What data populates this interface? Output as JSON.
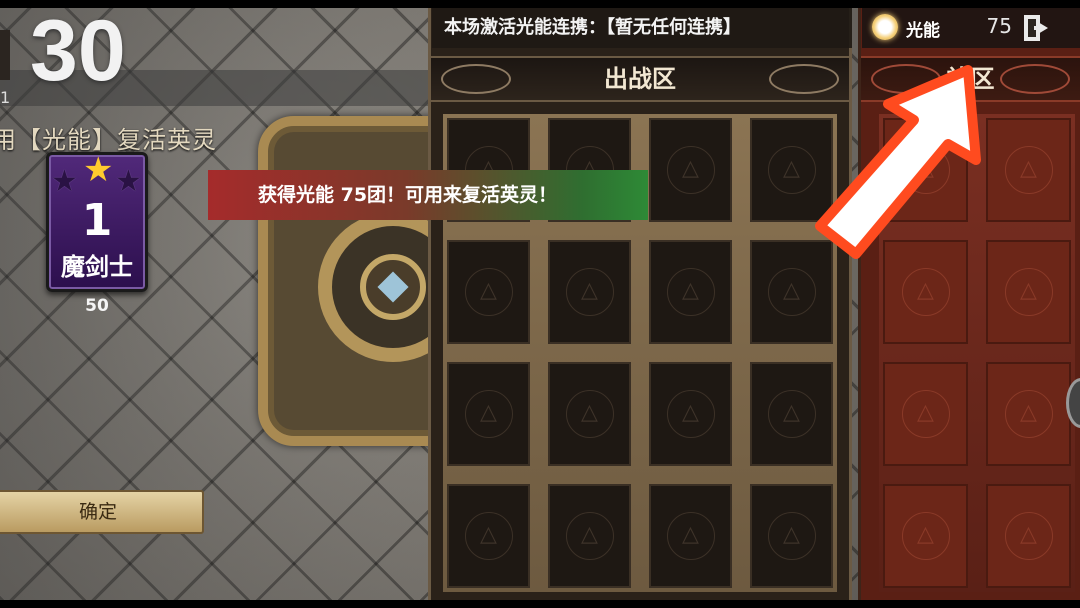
{
  "hud": {
    "counter": "30",
    "sub_number": "1",
    "hint_text": "用【光能】复活英灵"
  },
  "hero_card": {
    "level": "1",
    "name": "魔剑士",
    "cost": "50",
    "stars_filled": 1,
    "stars_total": 3,
    "card_color": "#51297a",
    "star_color": "#ffcb2e"
  },
  "confirm_button": {
    "label": "确定"
  },
  "toast": {
    "message": "获得光能 75团！可用来复活英灵！"
  },
  "link_bar": {
    "text": "本场激活光能连携：【暂无任何连携】"
  },
  "battle_zone": {
    "title": "出战区",
    "slots": 16
  },
  "reserve_zone": {
    "title": "补区",
    "slots": 8
  },
  "energy": {
    "icon": "sun-icon",
    "label": "光能",
    "value": "75"
  },
  "colors": {
    "battle_bg": "#2a2119",
    "reserve_bg": "#5a1f14",
    "arrow": "#ff4b1f"
  }
}
